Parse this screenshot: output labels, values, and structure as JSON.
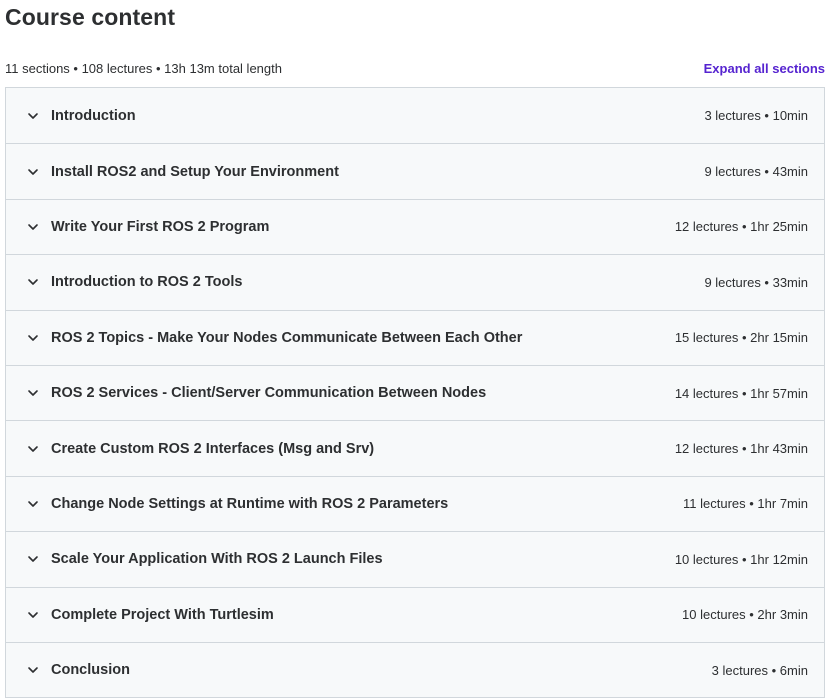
{
  "header": {
    "title": "Course content",
    "summary": "11 sections • 108 lectures • 13h 13m total length",
    "expand_all_label": "Expand all sections"
  },
  "colors": {
    "accent": "#5624d0",
    "text": "#2d2f31",
    "section_bg": "#f7f9fa",
    "border": "#d1d7dc"
  },
  "sections": [
    {
      "title": "Introduction",
      "meta": "3 lectures • 10min",
      "icon": "chevron-down-icon"
    },
    {
      "title": "Install ROS2 and Setup Your Environment",
      "meta": "9 lectures • 43min",
      "icon": "chevron-down-icon"
    },
    {
      "title": "Write Your First ROS 2 Program",
      "meta": "12 lectures • 1hr 25min",
      "icon": "chevron-down-icon"
    },
    {
      "title": "Introduction to ROS 2 Tools",
      "meta": "9 lectures • 33min",
      "icon": "chevron-down-icon"
    },
    {
      "title": "ROS 2 Topics - Make Your Nodes Communicate Between Each Other",
      "meta": "15 lectures • 2hr 15min",
      "icon": "chevron-down-icon"
    },
    {
      "title": "ROS 2 Services - Client/Server Communication Between Nodes",
      "meta": "14 lectures • 1hr 57min",
      "icon": "chevron-down-icon"
    },
    {
      "title": "Create Custom ROS 2 Interfaces (Msg and Srv)",
      "meta": "12 lectures • 1hr 43min",
      "icon": "chevron-down-icon"
    },
    {
      "title": "Change Node Settings at Runtime with ROS 2 Parameters",
      "meta": "11 lectures • 1hr 7min",
      "icon": "chevron-down-icon"
    },
    {
      "title": "Scale Your Application With ROS 2 Launch Files",
      "meta": "10 lectures • 1hr 12min",
      "icon": "chevron-down-icon"
    },
    {
      "title": "Complete Project With Turtlesim",
      "meta": "10 lectures • 2hr 3min",
      "icon": "chevron-down-icon"
    },
    {
      "title": "Conclusion",
      "meta": "3 lectures • 6min",
      "icon": "chevron-down-icon"
    }
  ]
}
